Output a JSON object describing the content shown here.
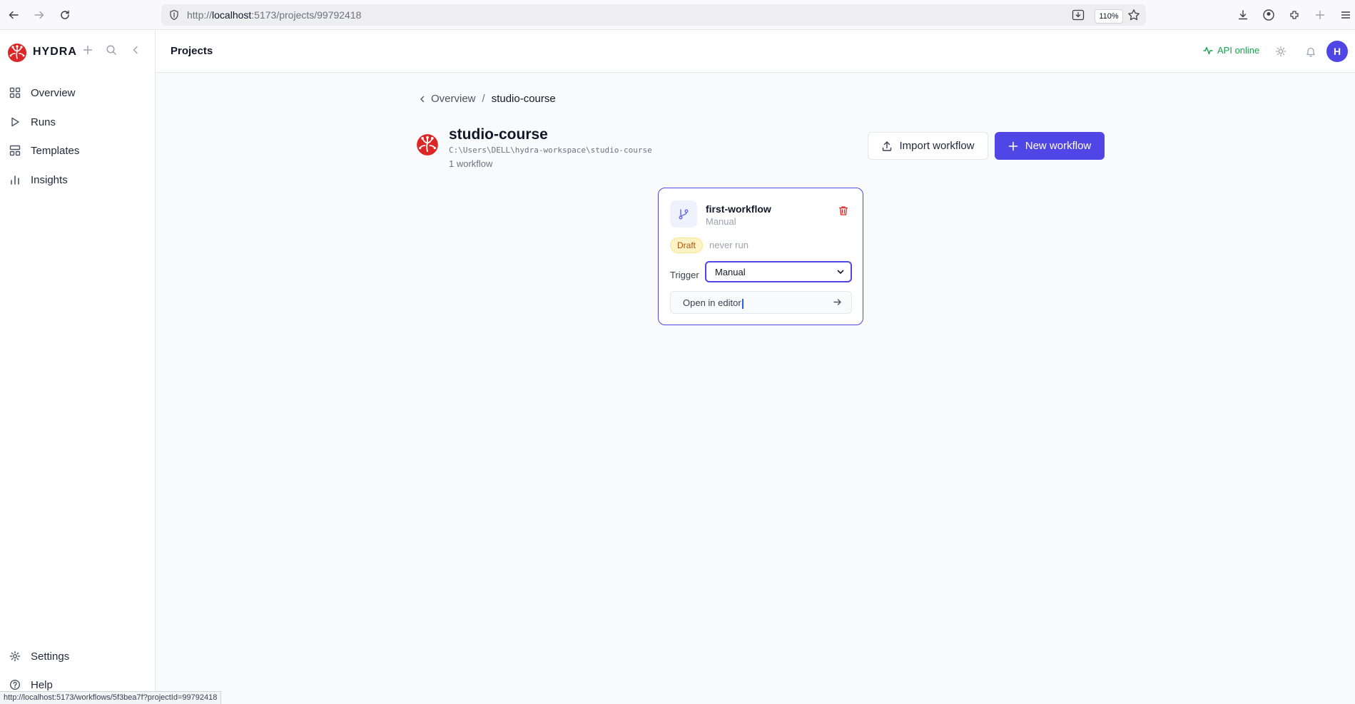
{
  "browser": {
    "url_prefix": "http://",
    "url_host": "localhost",
    "url_rest": ":5173/projects/99792418",
    "zoom": "110%",
    "status_url": "http://localhost:5173/workflows/5f3bea7f?projectId=99792418"
  },
  "sidebar": {
    "brand": "HYDRA",
    "items": [
      {
        "label": "Overview",
        "icon": "grid-icon"
      },
      {
        "label": "Runs",
        "icon": "play-icon"
      },
      {
        "label": "Templates",
        "icon": "layout-icon"
      },
      {
        "label": "Insights",
        "icon": "bar-chart-icon"
      }
    ],
    "bottom_items": [
      {
        "label": "Settings",
        "icon": "gear-icon"
      },
      {
        "label": "Help",
        "icon": "help-icon"
      }
    ]
  },
  "header": {
    "title": "Projects",
    "api_status": "API online",
    "avatar_initial": "H",
    "status_color": "#16a34a"
  },
  "breadcrumb": {
    "parent": "Overview",
    "separator": "/",
    "current": "studio-course"
  },
  "project": {
    "name": "studio-course",
    "path": "C:\\Users\\DELL\\hydra-workspace\\studio-course",
    "workflow_count": "1 workflow"
  },
  "actions": {
    "import_label": "Import workflow",
    "new_label": "New workflow",
    "accent_color": "#4f46e5"
  },
  "workflows": [
    {
      "name": "first-workflow",
      "trigger_type": "Manual",
      "status": "Draft",
      "last_run": "never run",
      "trigger_label": "Trigger",
      "trigger_value": "Manual",
      "open_label": "Open in editor"
    }
  ]
}
